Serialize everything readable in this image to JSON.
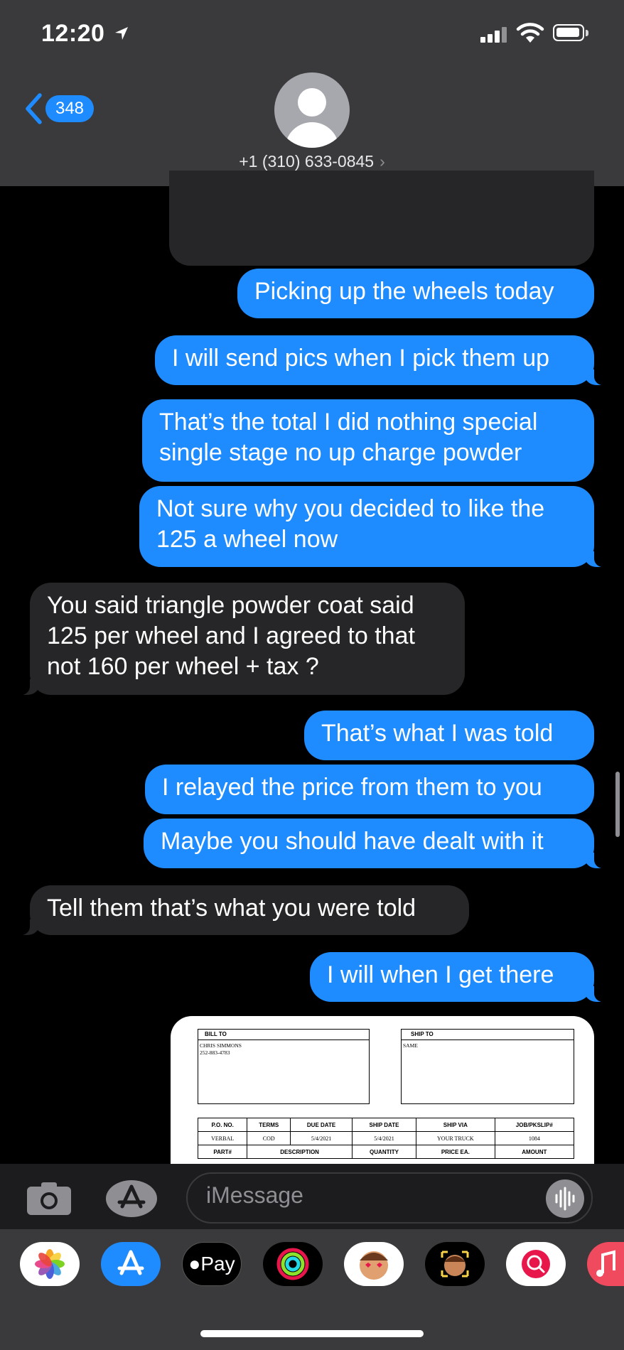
{
  "status_bar": {
    "time": "12:20"
  },
  "header": {
    "back_count": "348",
    "contact": "+1 (310) 633-0845",
    "contact_chevron": "›"
  },
  "messages": [
    {
      "type": "sent",
      "text": "Picking up the wheels today"
    },
    {
      "type": "sent",
      "text": "I will send pics when I pick them up"
    },
    {
      "type": "sent",
      "lines": [
        "That’s the total I did nothing special",
        "single stage no up charge powder"
      ]
    },
    {
      "type": "sent",
      "lines": [
        "Not sure why you decided to like the",
        "125 a wheel now"
      ]
    },
    {
      "type": "received",
      "lines": [
        "You said triangle powder coat said",
        "125 per wheel and I agreed to that",
        "not 160 per wheel + tax ?"
      ]
    },
    {
      "type": "sent",
      "text": "That’s what I was told"
    },
    {
      "type": "sent",
      "text": "I relayed the price from them to you"
    },
    {
      "type": "sent",
      "text": "Maybe you should have dealt with it"
    },
    {
      "type": "received",
      "text": "Tell them that’s what you were told"
    },
    {
      "type": "sent",
      "text": "I will when I get there"
    }
  ],
  "invoice": {
    "bill_to_label": "BILL TO",
    "bill_to_name": "CHRIS SIMMONS",
    "bill_to_phone": "252-883-4783",
    "ship_to_label": "SHIP TO",
    "ship_to_value": "SAME",
    "headers": [
      "P.O. NO.",
      "TERMS",
      "DUE DATE",
      "SHIP DATE",
      "SHIP VIA",
      "JOB/PKSLIP#"
    ],
    "values": [
      "VERBAL",
      "COD",
      "5/4/2021",
      "5/4/2021",
      "YOUR TRUCK",
      "1084"
    ],
    "item_headers": [
      "PART#",
      "DESCRIPTION",
      "QUANTITY",
      "PRICE EA.",
      "AMOUNT"
    ]
  },
  "input": {
    "placeholder": "iMessage"
  },
  "app_drawer": {
    "apps": [
      "photos-icon",
      "app-store-icon",
      "apple-pay-icon",
      "activity-icon",
      "memoji-stickers-icon",
      "animoji-icon",
      "web-search-icon",
      "music-icon"
    ],
    "apple_pay_label": "Pay"
  },
  "colors": {
    "sent": "#1e8bff",
    "received": "#262628",
    "header": "#3a3a3c",
    "background": "#000000"
  }
}
